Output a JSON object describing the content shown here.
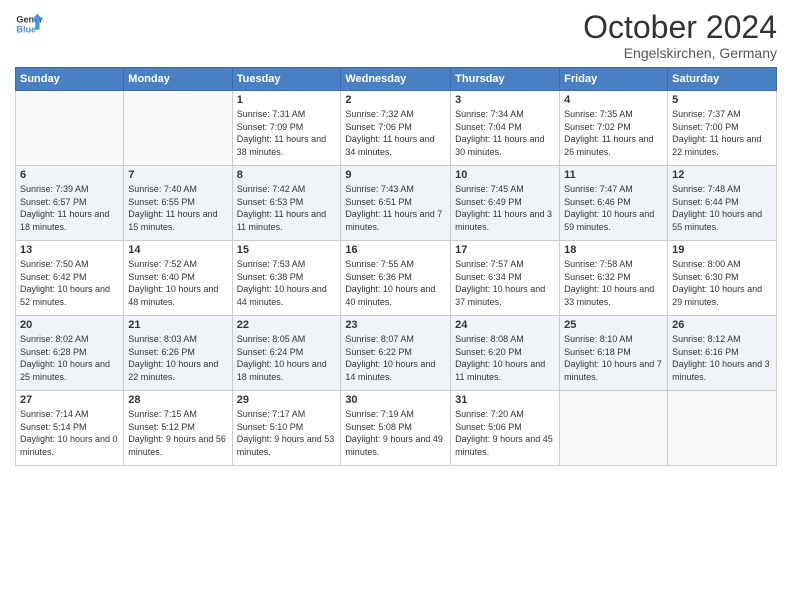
{
  "header": {
    "logo_general": "General",
    "logo_blue": "Blue",
    "month_title": "October 2024",
    "location": "Engelskirchen, Germany"
  },
  "weekdays": [
    "Sunday",
    "Monday",
    "Tuesday",
    "Wednesday",
    "Thursday",
    "Friday",
    "Saturday"
  ],
  "weeks": [
    [
      {
        "day": "",
        "sunrise": "",
        "sunset": "",
        "daylight": ""
      },
      {
        "day": "",
        "sunrise": "",
        "sunset": "",
        "daylight": ""
      },
      {
        "day": "1",
        "sunrise": "Sunrise: 7:31 AM",
        "sunset": "Sunset: 7:09 PM",
        "daylight": "Daylight: 11 hours and 38 minutes."
      },
      {
        "day": "2",
        "sunrise": "Sunrise: 7:32 AM",
        "sunset": "Sunset: 7:06 PM",
        "daylight": "Daylight: 11 hours and 34 minutes."
      },
      {
        "day": "3",
        "sunrise": "Sunrise: 7:34 AM",
        "sunset": "Sunset: 7:04 PM",
        "daylight": "Daylight: 11 hours and 30 minutes."
      },
      {
        "day": "4",
        "sunrise": "Sunrise: 7:35 AM",
        "sunset": "Sunset: 7:02 PM",
        "daylight": "Daylight: 11 hours and 26 minutes."
      },
      {
        "day": "5",
        "sunrise": "Sunrise: 7:37 AM",
        "sunset": "Sunset: 7:00 PM",
        "daylight": "Daylight: 11 hours and 22 minutes."
      }
    ],
    [
      {
        "day": "6",
        "sunrise": "Sunrise: 7:39 AM",
        "sunset": "Sunset: 6:57 PM",
        "daylight": "Daylight: 11 hours and 18 minutes."
      },
      {
        "day": "7",
        "sunrise": "Sunrise: 7:40 AM",
        "sunset": "Sunset: 6:55 PM",
        "daylight": "Daylight: 11 hours and 15 minutes."
      },
      {
        "day": "8",
        "sunrise": "Sunrise: 7:42 AM",
        "sunset": "Sunset: 6:53 PM",
        "daylight": "Daylight: 11 hours and 11 minutes."
      },
      {
        "day": "9",
        "sunrise": "Sunrise: 7:43 AM",
        "sunset": "Sunset: 6:51 PM",
        "daylight": "Daylight: 11 hours and 7 minutes."
      },
      {
        "day": "10",
        "sunrise": "Sunrise: 7:45 AM",
        "sunset": "Sunset: 6:49 PM",
        "daylight": "Daylight: 11 hours and 3 minutes."
      },
      {
        "day": "11",
        "sunrise": "Sunrise: 7:47 AM",
        "sunset": "Sunset: 6:46 PM",
        "daylight": "Daylight: 10 hours and 59 minutes."
      },
      {
        "day": "12",
        "sunrise": "Sunrise: 7:48 AM",
        "sunset": "Sunset: 6:44 PM",
        "daylight": "Daylight: 10 hours and 55 minutes."
      }
    ],
    [
      {
        "day": "13",
        "sunrise": "Sunrise: 7:50 AM",
        "sunset": "Sunset: 6:42 PM",
        "daylight": "Daylight: 10 hours and 52 minutes."
      },
      {
        "day": "14",
        "sunrise": "Sunrise: 7:52 AM",
        "sunset": "Sunset: 6:40 PM",
        "daylight": "Daylight: 10 hours and 48 minutes."
      },
      {
        "day": "15",
        "sunrise": "Sunrise: 7:53 AM",
        "sunset": "Sunset: 6:38 PM",
        "daylight": "Daylight: 10 hours and 44 minutes."
      },
      {
        "day": "16",
        "sunrise": "Sunrise: 7:55 AM",
        "sunset": "Sunset: 6:36 PM",
        "daylight": "Daylight: 10 hours and 40 minutes."
      },
      {
        "day": "17",
        "sunrise": "Sunrise: 7:57 AM",
        "sunset": "Sunset: 6:34 PM",
        "daylight": "Daylight: 10 hours and 37 minutes."
      },
      {
        "day": "18",
        "sunrise": "Sunrise: 7:58 AM",
        "sunset": "Sunset: 6:32 PM",
        "daylight": "Daylight: 10 hours and 33 minutes."
      },
      {
        "day": "19",
        "sunrise": "Sunrise: 8:00 AM",
        "sunset": "Sunset: 6:30 PM",
        "daylight": "Daylight: 10 hours and 29 minutes."
      }
    ],
    [
      {
        "day": "20",
        "sunrise": "Sunrise: 8:02 AM",
        "sunset": "Sunset: 6:28 PM",
        "daylight": "Daylight: 10 hours and 25 minutes."
      },
      {
        "day": "21",
        "sunrise": "Sunrise: 8:03 AM",
        "sunset": "Sunset: 6:26 PM",
        "daylight": "Daylight: 10 hours and 22 minutes."
      },
      {
        "day": "22",
        "sunrise": "Sunrise: 8:05 AM",
        "sunset": "Sunset: 6:24 PM",
        "daylight": "Daylight: 10 hours and 18 minutes."
      },
      {
        "day": "23",
        "sunrise": "Sunrise: 8:07 AM",
        "sunset": "Sunset: 6:22 PM",
        "daylight": "Daylight: 10 hours and 14 minutes."
      },
      {
        "day": "24",
        "sunrise": "Sunrise: 8:08 AM",
        "sunset": "Sunset: 6:20 PM",
        "daylight": "Daylight: 10 hours and 11 minutes."
      },
      {
        "day": "25",
        "sunrise": "Sunrise: 8:10 AM",
        "sunset": "Sunset: 6:18 PM",
        "daylight": "Daylight: 10 hours and 7 minutes."
      },
      {
        "day": "26",
        "sunrise": "Sunrise: 8:12 AM",
        "sunset": "Sunset: 6:16 PM",
        "daylight": "Daylight: 10 hours and 3 minutes."
      }
    ],
    [
      {
        "day": "27",
        "sunrise": "Sunrise: 7:14 AM",
        "sunset": "Sunset: 5:14 PM",
        "daylight": "Daylight: 10 hours and 0 minutes."
      },
      {
        "day": "28",
        "sunrise": "Sunrise: 7:15 AM",
        "sunset": "Sunset: 5:12 PM",
        "daylight": "Daylight: 9 hours and 56 minutes."
      },
      {
        "day": "29",
        "sunrise": "Sunrise: 7:17 AM",
        "sunset": "Sunset: 5:10 PM",
        "daylight": "Daylight: 9 hours and 53 minutes."
      },
      {
        "day": "30",
        "sunrise": "Sunrise: 7:19 AM",
        "sunset": "Sunset: 5:08 PM",
        "daylight": "Daylight: 9 hours and 49 minutes."
      },
      {
        "day": "31",
        "sunrise": "Sunrise: 7:20 AM",
        "sunset": "Sunset: 5:06 PM",
        "daylight": "Daylight: 9 hours and 45 minutes."
      },
      {
        "day": "",
        "sunrise": "",
        "sunset": "",
        "daylight": ""
      },
      {
        "day": "",
        "sunrise": "",
        "sunset": "",
        "daylight": ""
      }
    ]
  ]
}
